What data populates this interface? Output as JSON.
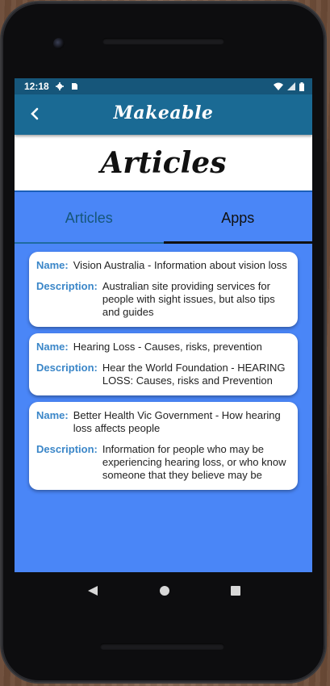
{
  "status_bar": {
    "time": "12:18"
  },
  "app_bar": {
    "brand": "Makeable"
  },
  "page": {
    "title": "Articles"
  },
  "tabs": [
    {
      "label": "Articles",
      "active": false
    },
    {
      "label": "Apps",
      "active": true
    }
  ],
  "labels": {
    "name": "Name:",
    "description": "Description:"
  },
  "items": [
    {
      "name": "Vision Australia - Information about vision loss",
      "description": "Australian site providing services for people with sight issues, but also tips and guides"
    },
    {
      "name": "Hearing Loss - Causes, risks, prevention",
      "description": "Hear the World Foundation - HEARING LOSS: Causes, risks and Prevention"
    },
    {
      "name": "Better Health Vic Government - How hearing loss affects people",
      "description": "Information for people who may be experiencing hearing loss, or who know someone that they believe may be"
    }
  ],
  "colors": {
    "status_bar": "#16567a",
    "app_bar": "#1a6a94",
    "content_bg": "#4a86f7",
    "label": "#3a86c8"
  }
}
